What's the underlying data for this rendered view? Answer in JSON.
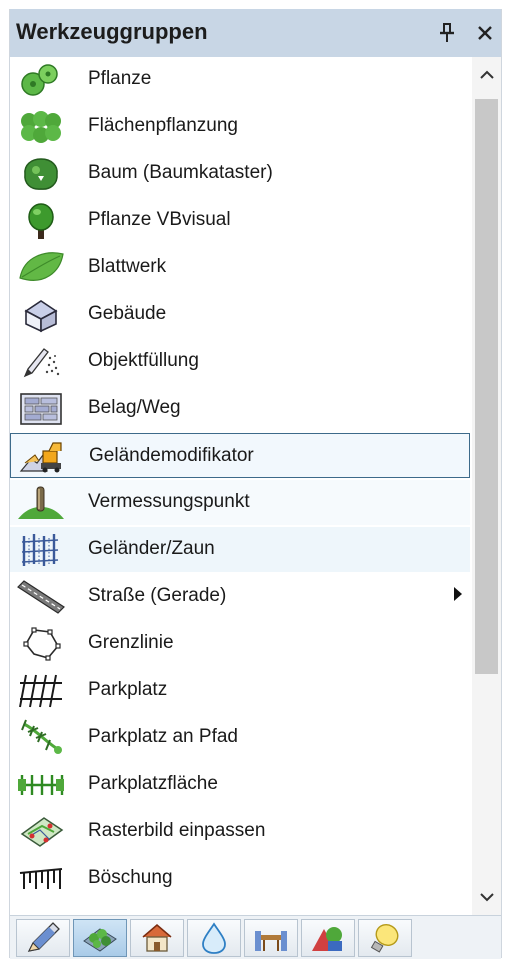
{
  "panel": {
    "title": "Werkzeuggruppen",
    "pin_icon": "pin-icon",
    "close_icon": "close-icon"
  },
  "items": [
    {
      "label": "Pflanze",
      "icon": "plant-icon"
    },
    {
      "label": "Flächenpflanzung",
      "icon": "area-planting-icon"
    },
    {
      "label": "Baum (Baumkataster)",
      "icon": "tree-cadastre-icon"
    },
    {
      "label": "Pflanze VBvisual",
      "icon": "tree-icon"
    },
    {
      "label": "Blattwerk",
      "icon": "leaf-icon"
    },
    {
      "label": "Gebäude",
      "icon": "building-icon"
    },
    {
      "label": "Objektfüllung",
      "icon": "spray-pencil-icon"
    },
    {
      "label": "Belag/Weg",
      "icon": "paving-icon"
    },
    {
      "label": "Geländemodifikator",
      "icon": "terrain-modifier-icon",
      "state": "selected"
    },
    {
      "label": "Vermessungspunkt",
      "icon": "survey-point-icon",
      "state": "tinted"
    },
    {
      "label": "Geländer/Zaun",
      "icon": "fence-icon",
      "state": "hovered"
    },
    {
      "label": "Straße (Gerade)",
      "icon": "road-icon",
      "has_submenu": true
    },
    {
      "label": "Grenzlinie",
      "icon": "boundary-icon"
    },
    {
      "label": "Parkplatz",
      "icon": "parking-icon"
    },
    {
      "label": "Parkplatz an Pfad",
      "icon": "parking-path-icon"
    },
    {
      "label": "Parkplatzfläche",
      "icon": "parking-area-icon"
    },
    {
      "label": "Rasterbild einpassen",
      "icon": "raster-image-icon"
    },
    {
      "label": "Böschung",
      "icon": "embankment-icon"
    }
  ],
  "scrollbar": {
    "up_icon": "chevron-up-icon",
    "down_icon": "chevron-down-icon"
  },
  "toolbar": [
    {
      "icon": "pencil-icon"
    },
    {
      "icon": "plants-icon",
      "active": true
    },
    {
      "icon": "house-icon"
    },
    {
      "icon": "water-drop-icon"
    },
    {
      "icon": "furniture-icon"
    },
    {
      "icon": "shapes-icon"
    },
    {
      "icon": "light-bulb-icon"
    }
  ],
  "colors": {
    "header": "#c8d6e5",
    "selection_border": "#3d6a8a",
    "accent_green": "#4fa83a"
  }
}
